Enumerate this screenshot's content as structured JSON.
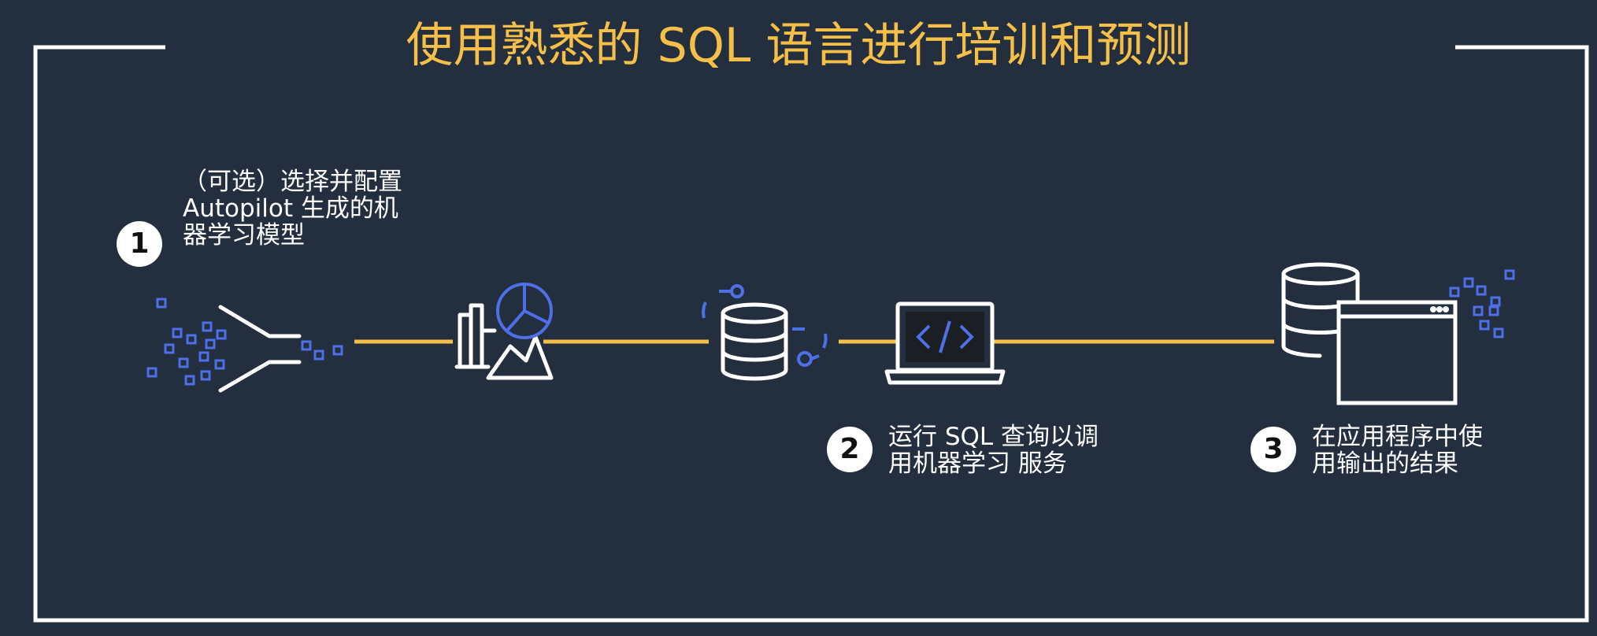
{
  "title": "使用熟悉的 SQL 语言进行培训和预测",
  "steps": [
    {
      "number": "1",
      "line1": "（可选）选择并配置",
      "line2": "Autopilot 生成的机",
      "line3": "器学习模型"
    },
    {
      "number": "2",
      "line1": "运行 SQL 查询以调",
      "line2": "用机器学习 服务"
    },
    {
      "number": "3",
      "line1": "在应用程序中使",
      "line2": "用输出的结果"
    }
  ],
  "icons": [
    "data-funnel-icon",
    "analytics-chart-icon",
    "database-icon",
    "code-laptop-icon",
    "database-window-icon"
  ],
  "colors": {
    "background": "#232f3e",
    "accent": "#f6bf47",
    "blue": "#4f6fe8",
    "white": "#ffffff"
  }
}
